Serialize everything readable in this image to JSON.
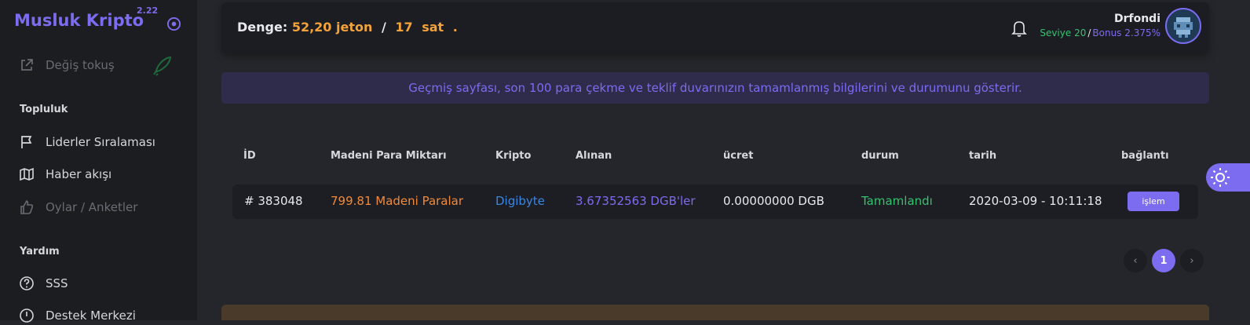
{
  "brand": {
    "name": "Musluk Kripto",
    "version": "2.22",
    "settings_icon": "circle-dot-icon"
  },
  "sidebar": {
    "items": [
      {
        "label": "Değiş tokuş",
        "icon": "external-link-icon",
        "disabled": true
      },
      {
        "label": "Liderler Sıralaması",
        "icon": "flag-icon"
      },
      {
        "label": "Haber akışı",
        "icon": "map-icon"
      },
      {
        "label": "Oylar / Anketler",
        "icon": "thumbs-up-icon",
        "disabled": true
      },
      {
        "label": "SSS",
        "icon": "help-circle-icon"
      },
      {
        "label": "Destek Merkezi",
        "icon": "alert-circle-icon"
      }
    ],
    "sections": {
      "community": "Topluluk",
      "help": "Yardım"
    }
  },
  "topbar": {
    "balance_label": "Denge:",
    "coins": "52,20 jeton",
    "separator": "/",
    "hours": "17",
    "hours_unit": "sat",
    "dot": "."
  },
  "user": {
    "name": "Drfondi",
    "level": "Seviye 20",
    "slash": "/",
    "bonus": "Bonus 2.375%"
  },
  "info": {
    "text": "Geçmiş sayfası, son 100 para çekme ve teklif duvarınızın tamamlanmış bilgilerini ve durumunu gösterir."
  },
  "table": {
    "headers": [
      "İD",
      "Madeni Para Miktarı",
      "Kripto",
      "Alınan",
      "ücret",
      "durum",
      "tarih",
      "bağlantı"
    ],
    "rows": [
      {
        "id": "# 383048",
        "amount": "799.81 Madeni Paralar",
        "crypto": "Digibyte",
        "received": "3.67352563 DGB'ler",
        "fee": "0.00000000 DGB",
        "status": "Tamamlandı",
        "date": "2020-03-09 - 10:11:18",
        "link_label": "işlem"
      }
    ]
  },
  "pagination": {
    "current": "1",
    "prev": "‹",
    "next": "›"
  },
  "colors": {
    "accent": "#7b6cf0",
    "orange": "#f4a23a",
    "green": "#33c36f",
    "blue": "#3a86e0"
  }
}
